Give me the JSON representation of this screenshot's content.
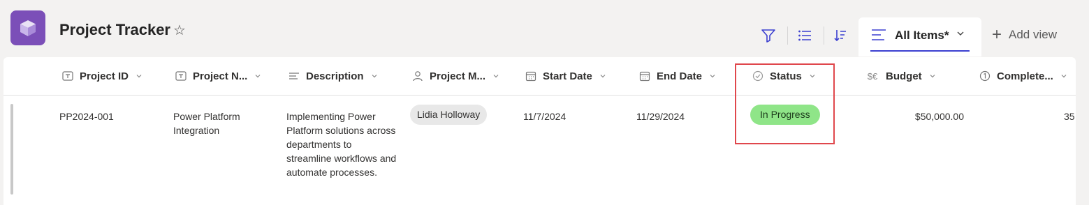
{
  "app": {
    "icon": "cube-icon",
    "accent": "#7b4fb8",
    "title": "Project Tracker",
    "favorite_icon": "star-icon"
  },
  "toolbar": {
    "filter_icon": "filter-icon",
    "group_icon": "group-list-icon",
    "sort_icon": "sort-icon"
  },
  "view": {
    "active_label": "All Items*",
    "add_label": "Add view",
    "underline_color": "#3b3fd0"
  },
  "columns": [
    {
      "label": "Project ID",
      "icon": "text-field-icon"
    },
    {
      "label": "Project N...",
      "icon": "text-field-icon"
    },
    {
      "label": "Description",
      "icon": "multiline-text-icon"
    },
    {
      "label": "Project M...",
      "icon": "person-icon"
    },
    {
      "label": "Start Date",
      "icon": "calendar-icon"
    },
    {
      "label": "End Date",
      "icon": "calendar-icon"
    },
    {
      "label": "Status",
      "icon": "choice-icon"
    },
    {
      "label": "Budget",
      "icon": "currency-icon"
    },
    {
      "label": "Complete...",
      "icon": "number-icon"
    }
  ],
  "rows": [
    {
      "project_id": "PP2024-001",
      "project_name": "Power Platform Integration",
      "description": "Implementing Power Platform solutions across departments to streamline workflows and automate processes.",
      "project_manager": "Lidia Holloway",
      "start_date": "11/7/2024",
      "end_date": "11/29/2024",
      "status": "In Progress",
      "status_color": "#8fe588",
      "budget": "$50,000.00",
      "complete": "35"
    }
  ],
  "highlight_color": "#e0474c"
}
